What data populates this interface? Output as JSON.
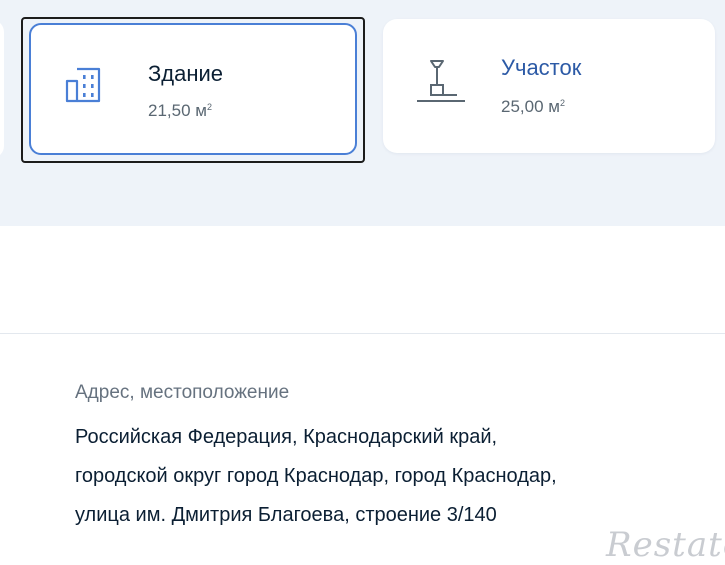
{
  "cards": [
    {
      "title": "Здание",
      "area": "21,50 м",
      "area_unit_sup": "2",
      "icon": "building-icon",
      "selected": true
    },
    {
      "title": "Участок",
      "area": "25,00 м",
      "area_unit_sup": "2",
      "icon": "land-plot-icon",
      "selected": false
    }
  ],
  "address": {
    "label": "Адрес, местоположение",
    "lines": [
      "Российская Федерация, Краснодарский край,",
      "городской округ город Краснодар, город Краснодар,",
      "улица им. Дмитрия Благоева, строение 3/140"
    ]
  },
  "watermark": "Restate",
  "colors": {
    "accent": "#4a7fd6",
    "link": "#2c5aa6",
    "band": "#eef3f9",
    "text": "#0b1f33"
  }
}
